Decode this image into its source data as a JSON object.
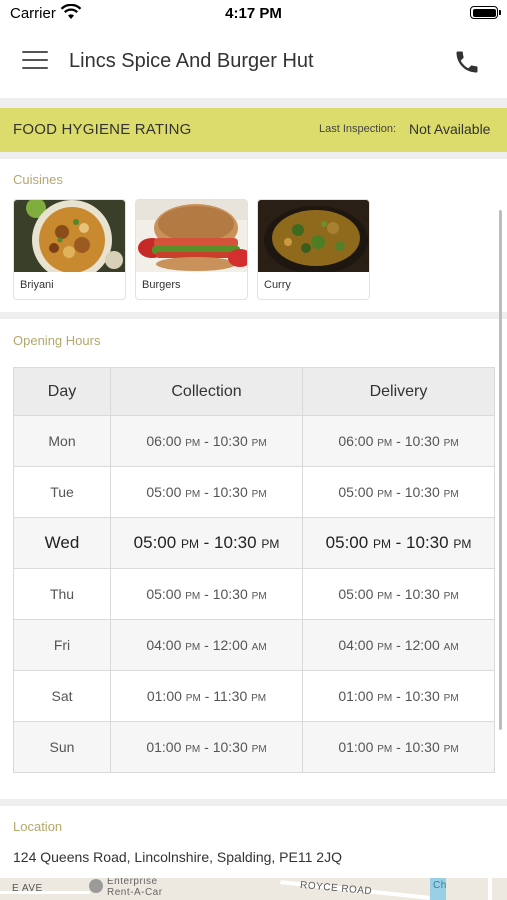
{
  "status_bar": {
    "carrier": "Carrier",
    "time": "4:17 PM"
  },
  "header": {
    "title": "Lincs Spice And Burger Hut",
    "menu_icon": "hamburger-menu-icon",
    "call_icon": "phone-icon"
  },
  "hygiene": {
    "title": "FOOD HYGIENE RATING",
    "last_inspection_label": "Last Inspection:",
    "last_inspection_value": "Not Available",
    "color": "#dcdc6c"
  },
  "cuisines": {
    "label": "Cuisines",
    "items": [
      {
        "name": "Briyani"
      },
      {
        "name": "Burgers"
      },
      {
        "name": "Curry"
      }
    ]
  },
  "opening_hours": {
    "label": "Opening Hours",
    "columns": [
      "Day",
      "Collection",
      "Delivery"
    ],
    "rows": [
      {
        "day": "Mon",
        "collection": {
          "start": "06:00",
          "start_ampm": "PM",
          "end": "10:30",
          "end_ampm": "PM"
        },
        "delivery": {
          "start": "06:00",
          "start_ampm": "PM",
          "end": "10:30",
          "end_ampm": "PM"
        }
      },
      {
        "day": "Tue",
        "collection": {
          "start": "05:00",
          "start_ampm": "PM",
          "end": "10:30",
          "end_ampm": "PM"
        },
        "delivery": {
          "start": "05:00",
          "start_ampm": "PM",
          "end": "10:30",
          "end_ampm": "PM"
        }
      },
      {
        "day": "Wed",
        "collection": {
          "start": "05:00",
          "start_ampm": "PM",
          "end": "10:30",
          "end_ampm": "PM"
        },
        "delivery": {
          "start": "05:00",
          "start_ampm": "PM",
          "end": "10:30",
          "end_ampm": "PM"
        }
      },
      {
        "day": "Thu",
        "collection": {
          "start": "05:00",
          "start_ampm": "PM",
          "end": "10:30",
          "end_ampm": "PM"
        },
        "delivery": {
          "start": "05:00",
          "start_ampm": "PM",
          "end": "10:30",
          "end_ampm": "PM"
        }
      },
      {
        "day": "Fri",
        "collection": {
          "start": "04:00",
          "start_ampm": "PM",
          "end": "12:00",
          "end_ampm": "AM"
        },
        "delivery": {
          "start": "04:00",
          "start_ampm": "PM",
          "end": "12:00",
          "end_ampm": "AM"
        }
      },
      {
        "day": "Sat",
        "collection": {
          "start": "01:00",
          "start_ampm": "PM",
          "end": "11:30",
          "end_ampm": "PM"
        },
        "delivery": {
          "start": "01:00",
          "start_ampm": "PM",
          "end": "10:30",
          "end_ampm": "PM"
        }
      },
      {
        "day": "Sun",
        "collection": {
          "start": "01:00",
          "start_ampm": "PM",
          "end": "10:30",
          "end_ampm": "PM"
        },
        "delivery": {
          "start": "01:00",
          "start_ampm": "PM",
          "end": "10:30",
          "end_ampm": "PM"
        }
      }
    ]
  },
  "location": {
    "label": "Location",
    "address": "124 Queens Road, Lincolnshire, Spalding, PE11 2JQ",
    "map_labels": {
      "road_left": "E AVE",
      "poi": "Enterprise Rent-A-Car",
      "road_right": "ROYCE ROAD",
      "partial": "Ch"
    }
  }
}
